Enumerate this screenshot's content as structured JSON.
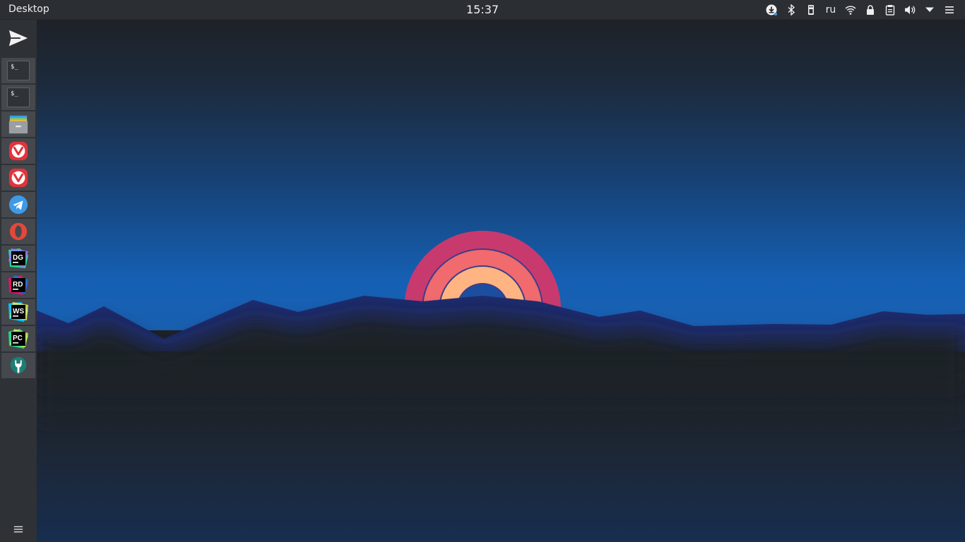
{
  "panel": {
    "title": "Desktop",
    "clock": "15:37",
    "keyboard_layout": "ru"
  },
  "dock": {
    "terminal_prompt": "$_",
    "app_monograms": {
      "datagrip": "DG",
      "rider": "RD",
      "webstorm": "WS",
      "pycharm": "PC"
    }
  },
  "colors": {
    "panel_bg": "#2b2e33",
    "dock_bg": "#2e3136",
    "dock_item_bg": "#45484d",
    "vivaldi_red": "#e0343c",
    "telegram_blue": "#3d9ae8",
    "opera_red": "#e4473b"
  }
}
